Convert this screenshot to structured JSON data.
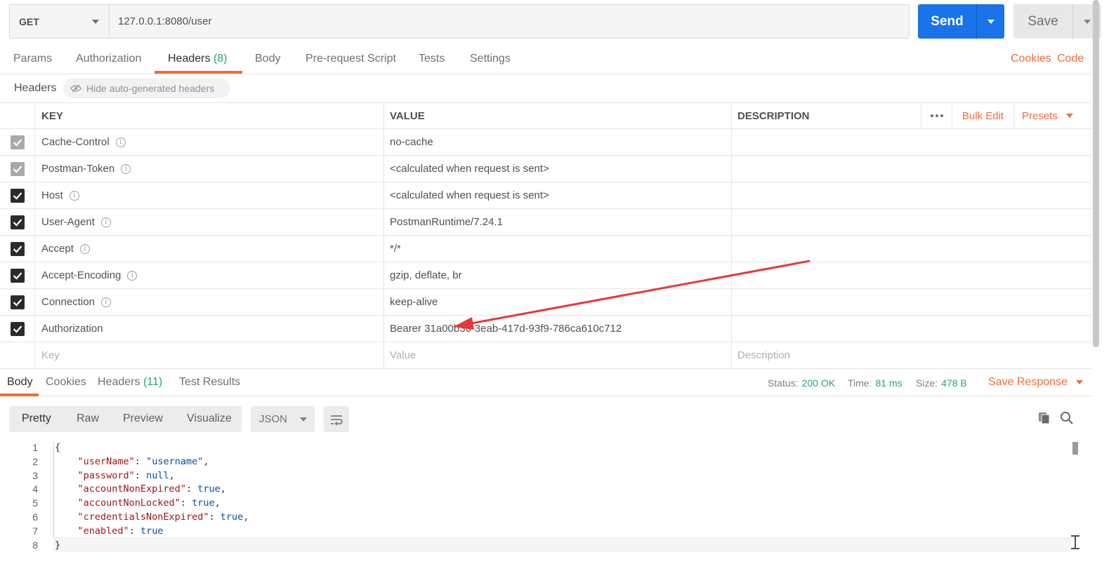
{
  "request": {
    "method": "GET",
    "url": "127.0.0.1:8080/user",
    "send_label": "Send",
    "save_label": "Save"
  },
  "tabs": [
    {
      "label": "Params"
    },
    {
      "label": "Authorization"
    },
    {
      "label": "Headers",
      "count": "(8)"
    },
    {
      "label": "Body"
    },
    {
      "label": "Pre-request Script"
    },
    {
      "label": "Tests"
    },
    {
      "label": "Settings"
    }
  ],
  "tab_links": {
    "cookies": "Cookies",
    "code": "Code"
  },
  "headers_bar": {
    "label": "Headers",
    "hide_btn": "Hide auto-generated headers"
  },
  "headers_table": {
    "col_key": "KEY",
    "col_value": "VALUE",
    "col_desc": "DESCRIPTION",
    "bulk_edit": "Bulk Edit",
    "presets": "Presets",
    "rows": [
      {
        "key": "Cache-Control",
        "value": "no-cache",
        "checked": "auto"
      },
      {
        "key": "Postman-Token",
        "value": "<calculated when request is sent>",
        "checked": "auto"
      },
      {
        "key": "Host",
        "value": "<calculated when request is sent>",
        "checked": "true"
      },
      {
        "key": "User-Agent",
        "value": "PostmanRuntime/7.24.1",
        "checked": "true"
      },
      {
        "key": "Accept",
        "value": "*/*",
        "checked": "true"
      },
      {
        "key": "Accept-Encoding",
        "value": "gzip, deflate, br",
        "checked": "true"
      },
      {
        "key": "Connection",
        "value": "keep-alive",
        "checked": "true"
      },
      {
        "key": "Authorization",
        "value": "Bearer 31a00b30-3eab-417d-93f9-786ca610c712",
        "checked": "true"
      }
    ],
    "placeholder": {
      "key": "Key",
      "value": "Value",
      "desc": "Description"
    }
  },
  "response": {
    "tabs": [
      {
        "label": "Body"
      },
      {
        "label": "Cookies"
      },
      {
        "label": "Headers",
        "count": "(11)"
      },
      {
        "label": "Test Results"
      }
    ],
    "status_label": "Status:",
    "status": "200 OK",
    "time_label": "Time:",
    "time": "81 ms",
    "size_label": "Size:",
    "size": "478 B",
    "save_response": "Save Response",
    "view_modes": [
      "Pretty",
      "Raw",
      "Preview",
      "Visualize"
    ],
    "format": "JSON",
    "code_lines": [
      {
        "n": "1",
        "html": "{"
      },
      {
        "n": "2",
        "key": "\"userName\"",
        "val": "\"username\"",
        "vtype": "s",
        "comma": ","
      },
      {
        "n": "3",
        "key": "\"password\"",
        "val": "null",
        "vtype": "kw",
        "comma": ","
      },
      {
        "n": "4",
        "key": "\"accountNonExpired\"",
        "val": "true",
        "vtype": "kw",
        "comma": ","
      },
      {
        "n": "5",
        "key": "\"accountNonLocked\"",
        "val": "true",
        "vtype": "kw",
        "comma": ","
      },
      {
        "n": "6",
        "key": "\"credentialsNonExpired\"",
        "val": "true",
        "vtype": "kw",
        "comma": ","
      },
      {
        "n": "7",
        "key": "\"enabled\"",
        "val": "true",
        "vtype": "kw",
        "comma": ""
      },
      {
        "n": "8",
        "html": "}"
      }
    ]
  },
  "colors": {
    "accent": "#f26b3a",
    "send": "#1a73e8",
    "success": "#2aa36b",
    "annotation_arrow": "#e8373b"
  },
  "icons": [
    "chevron-down-icon",
    "eye-off-icon",
    "info-icon",
    "checkbox-icon",
    "more-icon",
    "wrap-icon",
    "copy-icon",
    "search-icon"
  ]
}
